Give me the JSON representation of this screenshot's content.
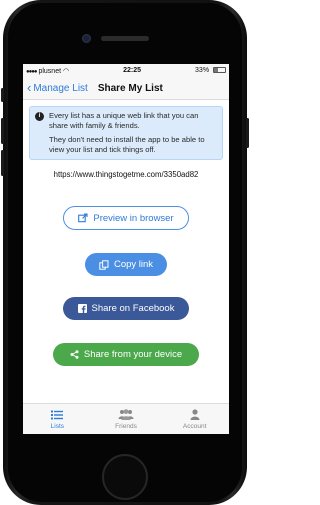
{
  "status": {
    "carrier": "plusnet",
    "time": "22:25",
    "battery": "33%",
    "battery_level": 0.33
  },
  "nav": {
    "back_label": "Manage List",
    "title": "Share My List"
  },
  "info": {
    "line1": "Every list has a unique web link that you can share with family & friends.",
    "line2": "They don't need to install the app to be able to view your list and tick things off."
  },
  "share_url": "https://www.thingstogetme.com/3350ad82",
  "buttons": {
    "preview": "Preview in browser",
    "copy": "Copy link",
    "facebook": "Share on Facebook",
    "device": "Share from your device"
  },
  "tabs": [
    {
      "label": "Lists",
      "icon": "list-icon",
      "active": true
    },
    {
      "label": "Friends",
      "icon": "friends-icon",
      "active": false
    },
    {
      "label": "Account",
      "icon": "person-icon",
      "active": false
    }
  ],
  "colors": {
    "accent": "#2f7bd9",
    "copy_button": "#4a8fe3",
    "facebook": "#3b5998",
    "device": "#4ba84b",
    "info_bg": "#dcebfb"
  }
}
